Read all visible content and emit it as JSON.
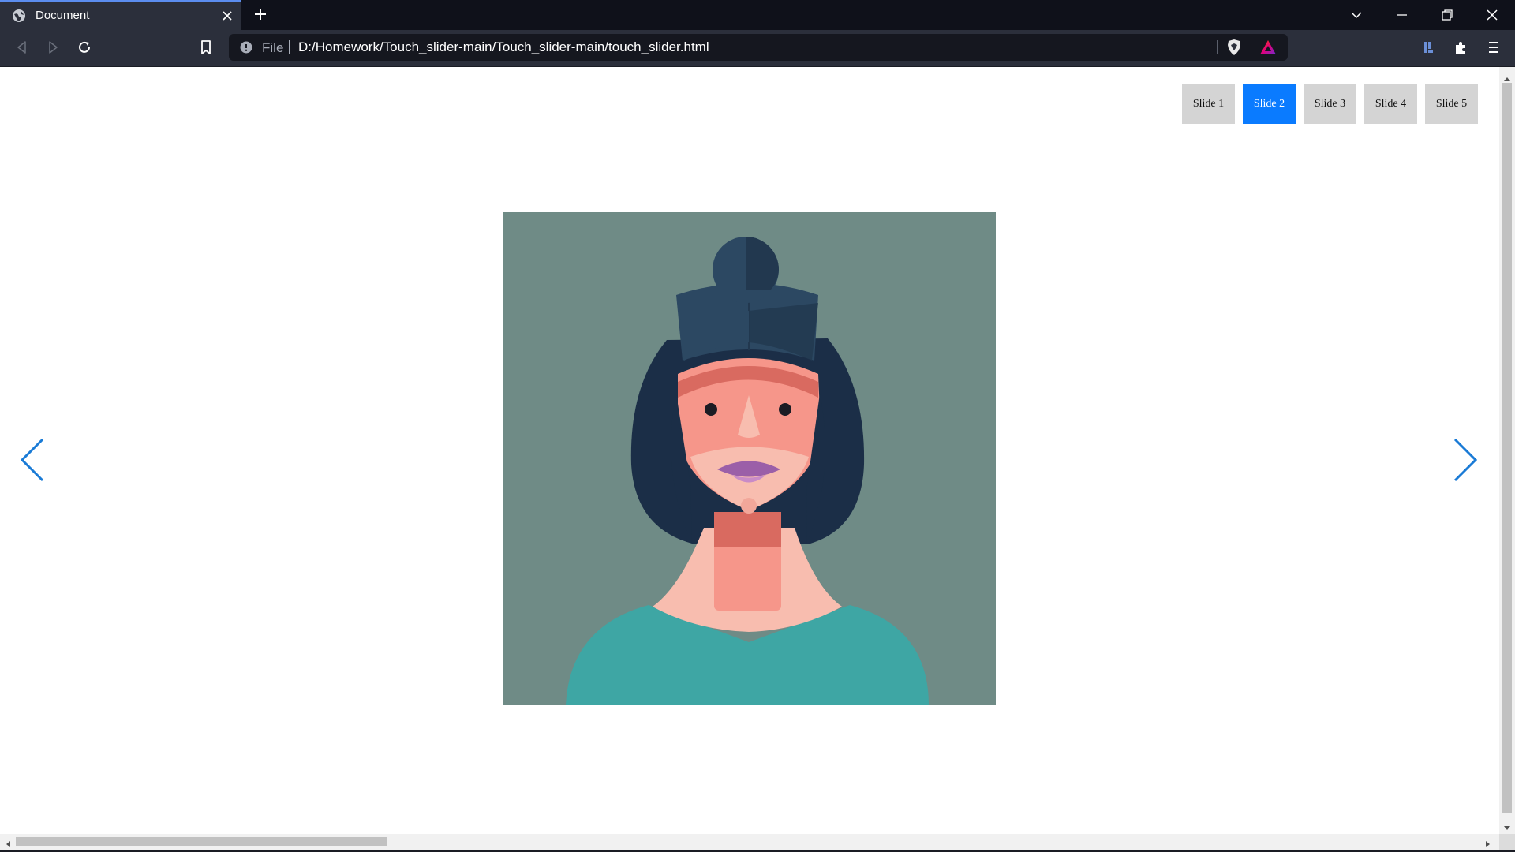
{
  "browser": {
    "tab_title": "Document",
    "icons": {
      "favicon": "globe-icon",
      "tab_close": "close-icon",
      "new_tab": "plus-icon",
      "tab_search": "chevron-down-icon",
      "minimize": "minimize-icon",
      "restore": "restore-icon",
      "close": "close-icon",
      "back": "back-icon",
      "forward": "forward-icon",
      "reload": "reload-icon",
      "bookmark": "bookmark-icon",
      "site_info": "info-icon",
      "shield": "brave-shield-icon",
      "rewards": "brave-rewards-icon",
      "sidebar": "sidebar-icon",
      "extensions": "puzzle-icon",
      "menu": "menu-icon"
    },
    "url_scheme": "File",
    "url": "D:/Homework/Touch_slider-main/Touch_slider-main/touch_slider.html",
    "colors": {
      "tabbar_bg": "#0f111a",
      "toolbar_bg": "#2b2f3b",
      "urlbar_bg": "#15171f"
    }
  },
  "page": {
    "slide_nav": [
      {
        "label": "Slide 1",
        "active": false
      },
      {
        "label": "Slide 2",
        "active": true
      },
      {
        "label": "Slide 3",
        "active": false
      },
      {
        "label": "Slide 4",
        "active": false
      },
      {
        "label": "Slide 5",
        "active": false
      }
    ],
    "prev_arrow_icon": "chevron-left-icon",
    "next_arrow_icon": "chevron-right-icon",
    "colors": {
      "accent": "#0a7bff",
      "inactive_button": "#d4d4d4",
      "slide_background": "#6f8b86"
    }
  }
}
